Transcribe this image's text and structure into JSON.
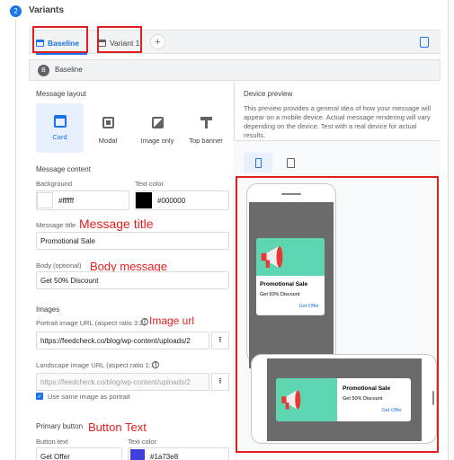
{
  "section": {
    "step": "2",
    "title": "Variants"
  },
  "tabs": {
    "baseline": "Baseline",
    "variant1": "Variant 1",
    "add": "+"
  },
  "baseline_header": {
    "badge": "B",
    "label": "Baseline"
  },
  "layout": {
    "heading": "Message layout",
    "options": [
      "Card",
      "Modal",
      "Image only",
      "Top banner"
    ],
    "selected": "Card"
  },
  "content": {
    "heading": "Message content",
    "background_label": "Background",
    "background_value": "#ffffff",
    "textcolor_label": "Text color",
    "textcolor_value": "#000000"
  },
  "title": {
    "label": "Message title",
    "value": "Promotional Sale"
  },
  "body": {
    "label": "Body (optional)",
    "value": "Get 50% Discount"
  },
  "images": {
    "heading": "Images",
    "portrait_label": "Portrait image URL (aspect ratio 3:2)",
    "portrait_value": "https://feedcheck.co/blog/wp-content/uploads/2",
    "landscape_label": "Landscape image URL (aspect ratio 1:1)",
    "landscape_value": "https://feedcheck.co/blog/wp-content/uploads/2",
    "checkbox": "Use same image as portrait"
  },
  "button": {
    "heading": "Primary button",
    "text_label": "Button text",
    "text_value": "Get Offer",
    "color_label": "Text color",
    "color_value": "#1a73e8"
  },
  "annotations": {
    "title": "Message title",
    "body": "Body message",
    "image": "Image url",
    "button": "Button Text"
  },
  "preview": {
    "heading": "Device preview",
    "description": "This preview provides a general idea of how your message will appear on a mobile device. Actual message rendering will vary depending on the device. Test with a real device for actual results.",
    "card_title": "Promotional Sale",
    "card_body": "Get 50% Discount",
    "card_button": "Get Offer"
  },
  "colors": {
    "accent": "#1a73e8",
    "annotation": "#e02020",
    "image_bg": "#5ed6b2"
  }
}
